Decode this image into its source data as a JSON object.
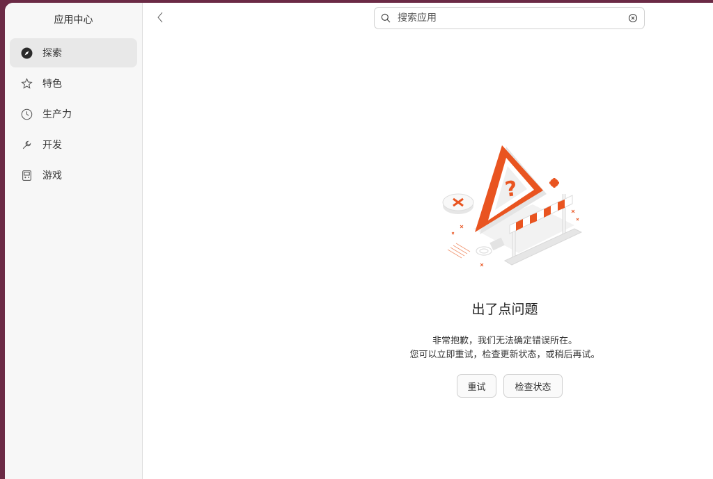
{
  "sidebar": {
    "title": "应用中心",
    "items": [
      {
        "label": "探索",
        "icon": "compass-icon",
        "active": true
      },
      {
        "label": "特色",
        "icon": "star-icon",
        "active": false
      },
      {
        "label": "生产力",
        "icon": "clock-icon",
        "active": false
      },
      {
        "label": "开发",
        "icon": "wrench-icon",
        "active": false
      },
      {
        "label": "游戏",
        "icon": "gamepad-icon",
        "active": false
      }
    ]
  },
  "search": {
    "placeholder": "搜索应用"
  },
  "error": {
    "title": "出了点问题",
    "line1": "非常抱歉，我们无法确定错误所在。",
    "line2": "您可以立即重试，检查更新状态，或稍后再试。"
  },
  "buttons": {
    "retry": "重试",
    "check_status": "检查状态"
  },
  "colors": {
    "accent": "#e95420",
    "sidebar_bg": "#f7f7f7",
    "active_item_bg": "#e8e8e8",
    "desktop_bg": "#6b2a45"
  }
}
